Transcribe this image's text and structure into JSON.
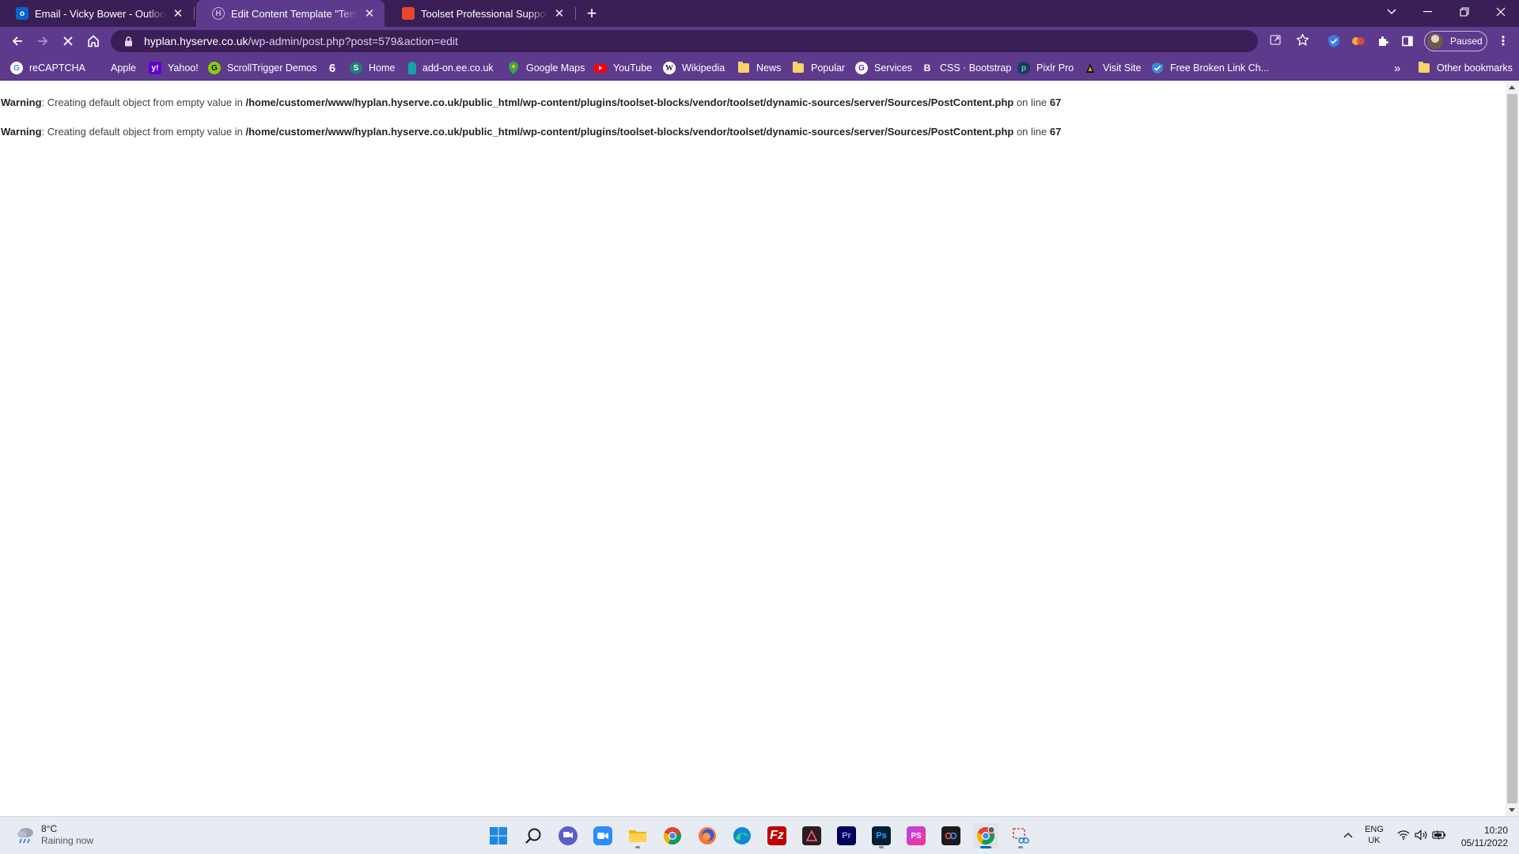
{
  "browser": {
    "tabs": [
      {
        "title": "Email - Vicky Bower - Outlook",
        "favicon": "outlook-icon",
        "active": false
      },
      {
        "title": "Edit Content Template \"Template",
        "favicon": "wordpress-hyserve-icon",
        "active": true
      },
      {
        "title": "Toolset Professional Support - To",
        "favicon": "toolset-icon",
        "active": false
      }
    ],
    "new_tab_label": "+",
    "window_controls": [
      "tab-search-icon",
      "minimize-icon",
      "restore-icon",
      "close-icon"
    ],
    "address": {
      "host": "hyplan.hyserve.co.uk",
      "path": "/wp-admin/post.php?post=579&action=edit"
    },
    "profile_label": "Paused",
    "bookmarks": [
      {
        "label": "reCAPTCHA",
        "icon": "google-icon"
      },
      {
        "label": "Apple",
        "icon": "apple-icon"
      },
      {
        "label": "Yahoo!",
        "icon": "yahoo-icon"
      },
      {
        "label": "ScrollTrigger Demos",
        "icon": "scrolltrigger-icon"
      },
      {
        "label": "",
        "icon": "six-icon"
      },
      {
        "label": "Home",
        "icon": "home-site-icon"
      },
      {
        "label": "add-on.ee.co.uk",
        "icon": "ee-icon"
      },
      {
        "label": "Google Maps",
        "icon": "google-maps-icon"
      },
      {
        "label": "YouTube",
        "icon": "youtube-icon"
      },
      {
        "label": "Wikipedia",
        "icon": "wikipedia-icon"
      },
      {
        "label": "News",
        "icon": "folder-icon"
      },
      {
        "label": "Popular",
        "icon": "folder-icon"
      },
      {
        "label": "Services",
        "icon": "services-icon"
      },
      {
        "label": "CSS · Bootstrap",
        "icon": "bootstrap-icon"
      },
      {
        "label": "Pixlr Pro",
        "icon": "pixlr-icon"
      },
      {
        "label": "Visit Site",
        "icon": "visit-site-icon"
      },
      {
        "label": "Free Broken Link Ch...",
        "icon": "broken-link-checker-icon"
      }
    ],
    "bookmarks_overflow": "»",
    "other_bookmarks": "Other bookmarks"
  },
  "page": {
    "warnings": [
      {
        "label": "Warning",
        "message": ": Creating default object from empty value in ",
        "path": "/home/customer/www/hyplan.hyserve.co.uk/public_html/wp-content/plugins/toolset-blocks/vendor/toolset/dynamic-sources/server/Sources/PostContent.php",
        "line_text": " on line ",
        "line": "67"
      },
      {
        "label": "Warning",
        "message": ": Creating default object from empty value in ",
        "path": "/home/customer/www/hyplan.hyserve.co.uk/public_html/wp-content/plugins/toolset-blocks/vendor/toolset/dynamic-sources/server/Sources/PostContent.php",
        "line_text": " on line ",
        "line": "67"
      }
    ]
  },
  "taskbar": {
    "weather": {
      "temp": "8°C",
      "condition": "Raining now"
    },
    "apps": [
      "windows-start-icon",
      "search-icon",
      "chat-icon",
      "zoom-icon",
      "file-explorer-icon",
      "chrome-icon",
      "firefox-icon",
      "edge-icon",
      "filezilla-icon",
      "affinity-icon",
      "premiere-pro-icon",
      "photoshop-icon",
      "phpstorm-icon",
      "creative-cloud-icon",
      "chrome-profile-icon",
      "snipping-tool-icon"
    ],
    "language": {
      "line1": "ENG",
      "line2": "UK"
    },
    "clock": {
      "time": "10:20",
      "date": "05/11/2022"
    }
  },
  "colors": {
    "tabstrip": "#3a1f57",
    "toolbar": "#5e3a8c",
    "taskbar": "#e7ebf2"
  }
}
